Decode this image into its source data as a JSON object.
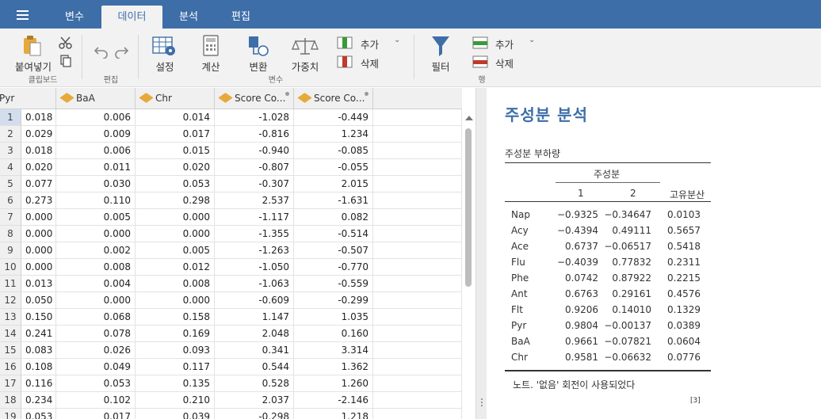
{
  "tabs": [
    "변수",
    "데이터",
    "분석",
    "편집"
  ],
  "active_tab": 1,
  "ribbon": {
    "clipboard": {
      "paste_label": "붙여넣기",
      "group": "클립보드"
    },
    "edit": {
      "group": "편집"
    },
    "variables": {
      "setup": "설정",
      "compute": "계산",
      "transform": "변환",
      "weights": "가중치",
      "add": "추가",
      "delete": "삭제",
      "group": "변수"
    },
    "rows": {
      "filter": "필터",
      "add": "추가",
      "delete": "삭제",
      "group": "행"
    }
  },
  "sheet": {
    "columns": [
      {
        "name": "Pyr",
        "type": "none"
      },
      {
        "name": "BaA",
        "type": "continuous"
      },
      {
        "name": "Chr",
        "type": "continuous"
      },
      {
        "name": "Score Co...",
        "type": "computed"
      },
      {
        "name": "Score Co...",
        "type": "computed"
      }
    ],
    "selected_row": 1,
    "rows": [
      [
        "1",
        "0.018",
        "0.006",
        "0.014",
        "-1.028",
        "-0.449"
      ],
      [
        "2",
        "0.029",
        "0.009",
        "0.017",
        "-0.816",
        "1.234"
      ],
      [
        "3",
        "0.018",
        "0.006",
        "0.015",
        "-0.940",
        "-0.085"
      ],
      [
        "4",
        "0.020",
        "0.011",
        "0.020",
        "-0.807",
        "-0.055"
      ],
      [
        "5",
        "0.077",
        "0.030",
        "0.053",
        "-0.307",
        "2.015"
      ],
      [
        "6",
        "0.273",
        "0.110",
        "0.298",
        "2.537",
        "-1.631"
      ],
      [
        "7",
        "0.000",
        "0.005",
        "0.000",
        "-1.117",
        "0.082"
      ],
      [
        "8",
        "0.000",
        "0.000",
        "0.000",
        "-1.355",
        "-0.514"
      ],
      [
        "9",
        "0.000",
        "0.002",
        "0.005",
        "-1.263",
        "-0.507"
      ],
      [
        "10",
        "0.000",
        "0.008",
        "0.012",
        "-1.050",
        "-0.770"
      ],
      [
        "11",
        "0.013",
        "0.004",
        "0.008",
        "-1.063",
        "-0.559"
      ],
      [
        "12",
        "0.050",
        "0.000",
        "0.000",
        "-0.609",
        "-0.299"
      ],
      [
        "13",
        "0.150",
        "0.068",
        "0.158",
        "1.147",
        "1.035"
      ],
      [
        "14",
        "0.241",
        "0.078",
        "0.169",
        "2.048",
        "0.160"
      ],
      [
        "15",
        "0.083",
        "0.026",
        "0.093",
        "0.341",
        "3.314"
      ],
      [
        "16",
        "0.108",
        "0.049",
        "0.117",
        "0.544",
        "1.362"
      ],
      [
        "17",
        "0.116",
        "0.053",
        "0.135",
        "0.528",
        "1.260"
      ],
      [
        "18",
        "0.234",
        "0.102",
        "0.210",
        "2.037",
        "-2.146"
      ],
      [
        "19",
        "0.053",
        "0.017",
        "0.039",
        "-0.298",
        "1.218"
      ]
    ]
  },
  "results": {
    "title": "주성분 분석",
    "table_title": "주성분 부하량",
    "component_header": "주성분",
    "col1": "1",
    "col2": "2",
    "uniqueness": "고유분산",
    "rows": [
      [
        "Nap",
        "−0.9325",
        "−0.34647",
        "0.0103"
      ],
      [
        "Acy",
        "−0.4394",
        "0.49111",
        "0.5657"
      ],
      [
        "Ace",
        "0.6737",
        "−0.06517",
        "0.5418"
      ],
      [
        "Flu",
        "−0.4039",
        "0.77832",
        "0.2311"
      ],
      [
        "Phe",
        "0.0742",
        "0.87922",
        "0.2215"
      ],
      [
        "Ant",
        "0.6763",
        "0.29161",
        "0.4576"
      ],
      [
        "Flt",
        "0.9206",
        "0.14010",
        "0.1329"
      ],
      [
        "Pyr",
        "0.9804",
        "−0.00137",
        "0.0389"
      ],
      [
        "BaA",
        "0.9661",
        "−0.07821",
        "0.0604"
      ],
      [
        "Chr",
        "0.9581",
        "−0.06632",
        "0.0776"
      ]
    ],
    "note": "노트. '없음' 회전이 사용되었다",
    "ref": "[3]"
  },
  "colors": {
    "brand": "#3e6ea8",
    "ruler": "#e6a93c"
  }
}
